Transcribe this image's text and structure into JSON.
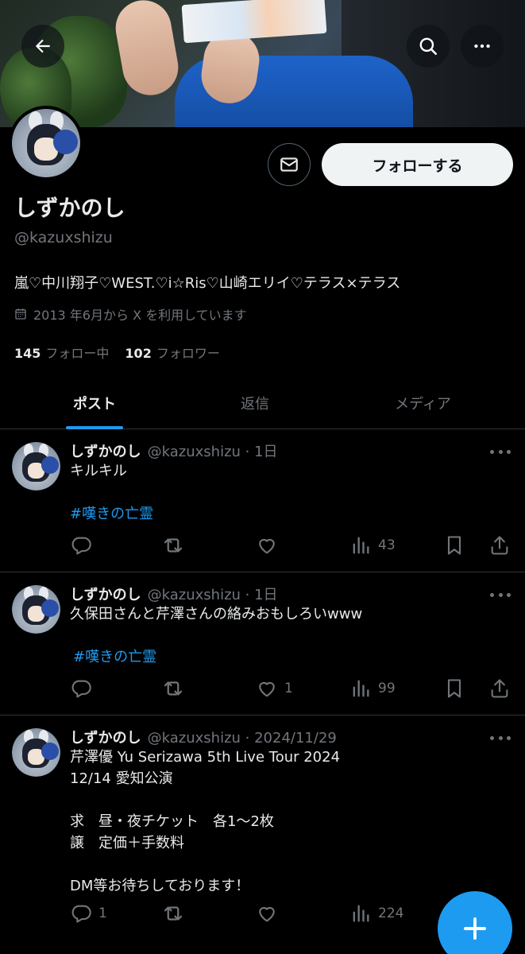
{
  "profile": {
    "display_name": "しずかのし",
    "handle": "@kazuxshizu",
    "bio": "嵐♡中川翔子♡WEST.♡i☆Ris♡山崎エリイ♡テラス×テラス",
    "joined": "2013 年6月から X を利用しています",
    "following_count": "145",
    "following_label": "フォロー中",
    "followers_count": "102",
    "followers_label": "フォロワー"
  },
  "header": {
    "back_icon": "arrow-left-icon",
    "search_icon": "search-icon",
    "more_icon": "more-horizontal-icon"
  },
  "buttons": {
    "message_icon": "envelope-icon",
    "follow_label": "フォローする"
  },
  "tabs": [
    {
      "label": "ポスト",
      "active": true
    },
    {
      "label": "返信",
      "active": false
    },
    {
      "label": "メディア",
      "active": false
    }
  ],
  "tweets": [
    {
      "name": "しずかのし",
      "handle": "@kazuxshizu",
      "date": "1日",
      "lines": [
        "キルキル"
      ],
      "hashtag": "#嘆きの亡霊",
      "replies": "",
      "reposts": "",
      "likes": "",
      "views": "43"
    },
    {
      "name": "しずかのし",
      "handle": "@kazuxshizu",
      "date": "1日",
      "lines": [
        "久保田さんと芹澤さんの絡みおもしろいwww"
      ],
      "hashtag": "#嘆きの亡霊",
      "replies": "",
      "reposts": "",
      "likes": "1",
      "views": "99"
    },
    {
      "name": "しずかのし",
      "handle": "@kazuxshizu",
      "date": "2024/11/29",
      "lines": [
        "芹澤優 Yu Serizawa 5th Live Tour 2024",
        "12/14 愛知公演",
        "",
        "求　昼・夜チケット　各1〜2枚",
        "譲　定価＋手数料",
        "",
        "DM等お待ちしております！"
      ],
      "hashtag": "",
      "replies": "1",
      "reposts": "",
      "likes": "",
      "views": "224"
    }
  ],
  "fab": {
    "icon": "plus-icon"
  },
  "colors": {
    "accent": "#1d9bf0",
    "background": "#000000",
    "muted": "#71767b",
    "text": "#e7e9ea"
  }
}
